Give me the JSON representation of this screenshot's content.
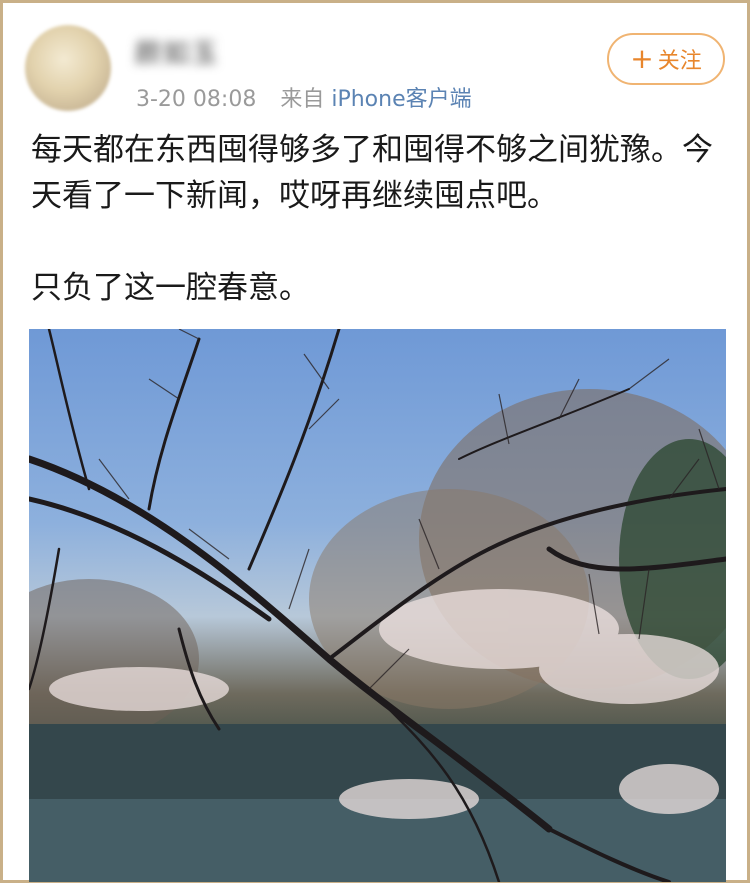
{
  "post": {
    "username": "颜如玉",
    "timestamp": "3-20 08:08",
    "source_prefix": "来自",
    "source": "iPhone客户端",
    "follow_plus": "+",
    "follow_label": "关注",
    "text_line1": "每天都在东西囤得够多了和囤得不够之间犹豫。今天看了一下新闻，哎呀再继续囤点吧。",
    "text_line2": "只负了这一腔春意。"
  },
  "icons": {
    "avatar": "avatar-blurred",
    "photo": "cherry-blossom-pond-photo"
  },
  "colors": {
    "frame": "#c9b088",
    "follow_accent": "#e8862c",
    "source_link": "#5b83b3"
  }
}
